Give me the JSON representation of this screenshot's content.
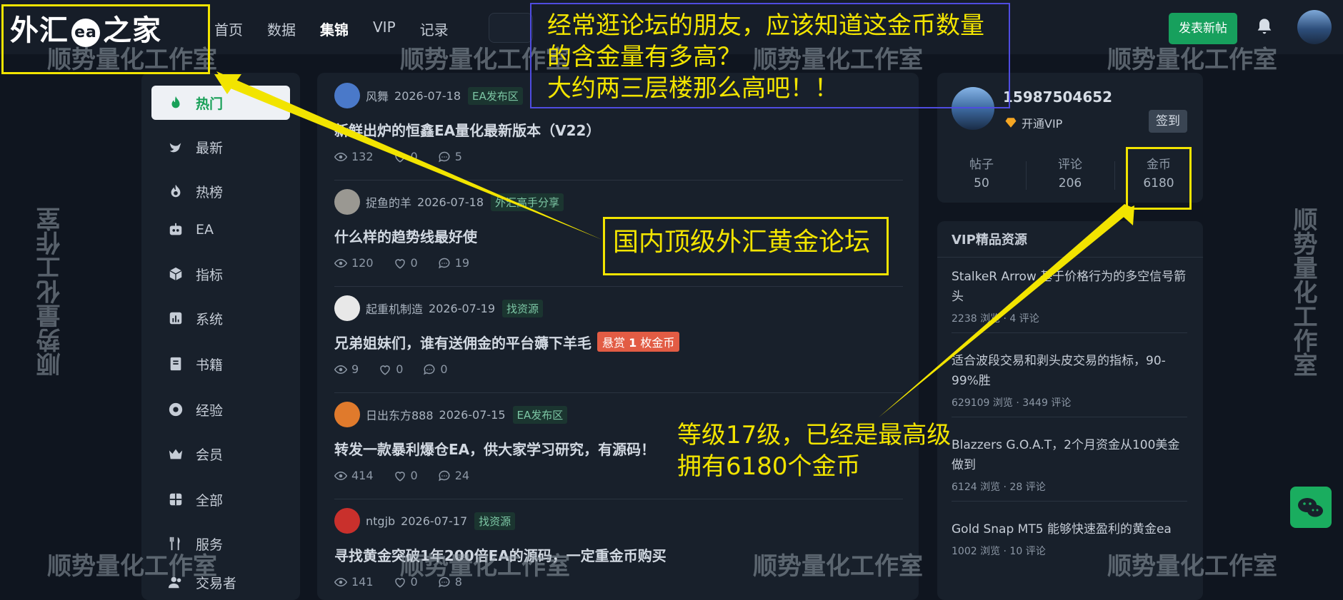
{
  "header": {
    "logo": {
      "pre": "外汇",
      "mid": "ea",
      "post": "之家"
    },
    "nav": [
      "首页",
      "数据",
      "集锦",
      "VIP",
      "记录"
    ],
    "nav_active_index": 2,
    "post_button": "发表新帖"
  },
  "sidebar": {
    "items": [
      {
        "label": "热门",
        "icon": "fire-icon",
        "active": true
      },
      {
        "label": "最新",
        "icon": "bird-icon"
      },
      {
        "label": "热榜",
        "icon": "flame-icon"
      },
      {
        "label": "EA",
        "icon": "robot-icon"
      },
      {
        "label": "指标",
        "icon": "cube-icon"
      },
      {
        "label": "系统",
        "icon": "bar-chart-icon"
      },
      {
        "label": "书籍",
        "icon": "book-icon"
      },
      {
        "label": "经验",
        "icon": "circle-icon"
      },
      {
        "label": "会员",
        "icon": "crown-icon"
      },
      {
        "label": "全部",
        "icon": "grid-icon"
      },
      {
        "label": "服务",
        "icon": "fork-knife-icon"
      },
      {
        "label": "交易者",
        "icon": "users-icon"
      }
    ]
  },
  "posts": [
    {
      "author": "风舞",
      "date": "2026-07-18",
      "tag": "EA发布区",
      "title": "新鲜出炉的恒鑫EA量化最新版本（V22）",
      "views": "132",
      "likes": "0",
      "comments": "5",
      "avatar_color": "#4a79c9"
    },
    {
      "author": "捉鱼的羊",
      "date": "2026-07-18",
      "tag": "外汇高手分享",
      "title": "什么样的趋势线最好使",
      "views": "120",
      "likes": "0",
      "comments": "19",
      "avatar_color": "#9a9892"
    },
    {
      "author": "起重机制造",
      "date": "2026-07-19",
      "tag": "找资源",
      "title": "兄弟姐妹们，谁有送佣金的平台薅下羊毛",
      "reward": {
        "pre": "悬赏",
        "num": "1",
        "post": "枚金币"
      },
      "views": "9",
      "likes": "0",
      "comments": "0",
      "avatar_color": "#e8e8e8"
    },
    {
      "author": "日出东方888",
      "date": "2026-07-15",
      "tag": "EA发布区",
      "title": "转发一款暴利爆仓EA，供大家学习研究，有源码！",
      "views": "414",
      "likes": "0",
      "comments": "24",
      "avatar_color": "#e07a2c"
    },
    {
      "author": "ntgjb",
      "date": "2026-07-17",
      "tag": "找资源",
      "title": "寻找黄金突破1年200倍EA的源码，一定重金币购买",
      "views": "141",
      "likes": "0",
      "comments": "8",
      "avatar_color": "#c9302c"
    }
  ],
  "user": {
    "name": "15987504652",
    "vip_label": "开通VIP",
    "signin": "签到",
    "stats": [
      {
        "label": "帖子",
        "value": "50"
      },
      {
        "label": "评论",
        "value": "206"
      },
      {
        "label": "金币",
        "value": "6180"
      }
    ]
  },
  "vip_resources": {
    "heading": "VIP精品资源",
    "items": [
      {
        "title": "StalkeR Arrow 基于价格行为的多空信号箭头",
        "stats": "2238 浏览 · 4 评论"
      },
      {
        "title": "适合波段交易和剥头皮交易的指标，90-99%胜",
        "stats": "629109 浏览 · 3449 评论"
      },
      {
        "title": "Blazzers G.O.A.T，2个月资金从100美金做到",
        "stats": "6124 浏览 · 28 评论"
      },
      {
        "title": "Gold Snap MT5 能够快速盈利的黄金ea",
        "stats": "1002 浏览 · 10 评论"
      }
    ]
  },
  "watermark": "顺势量化工作室",
  "annotations": {
    "top_text_line1": "经常逛论坛的朋友，应该知道这金币数量",
    "top_text_line2": "的含金量有多高？",
    "top_text_line3": "大约两三层楼那么高吧！！",
    "middle_box": "国内顶级外汇黄金论坛",
    "bottom_line1": "等级17级，已经是最高级",
    "bottom_line2": "拥有6180个金币"
  },
  "colors": {
    "accent_green": "#18a058",
    "annotation_yellow": "#f2e400",
    "annotation_blue": "#4f4ce0",
    "reward_red": "#e25c44"
  }
}
